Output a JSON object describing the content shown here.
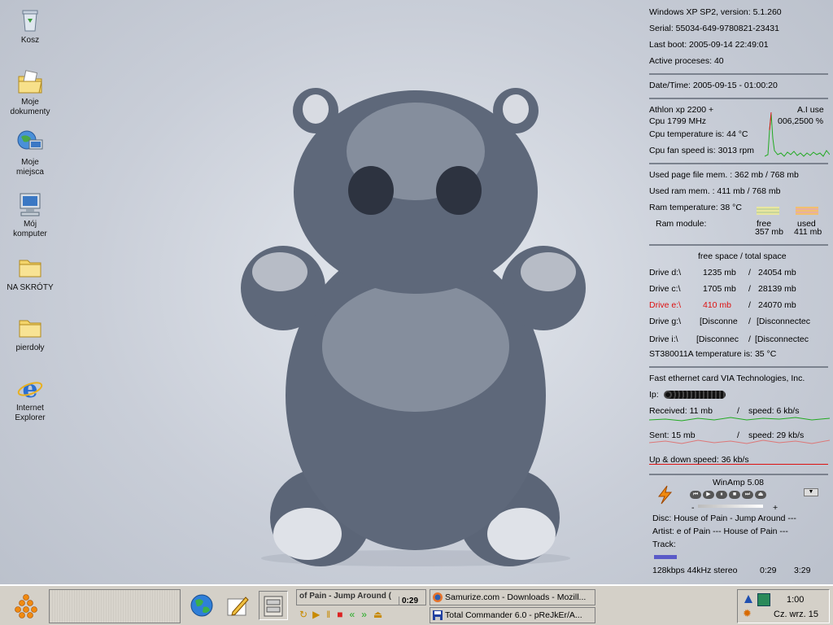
{
  "desktop_icons": [
    {
      "label": "Kosz",
      "icon": "recycle-bin-icon"
    },
    {
      "label": "Moje dokumenty",
      "icon": "my-documents-icon"
    },
    {
      "label": "Moje miejsca",
      "icon": "network-places-icon"
    },
    {
      "label": "Mój komputer",
      "icon": "my-computer-icon"
    },
    {
      "label": "NA SKRÓTY",
      "icon": "folder-icon"
    },
    {
      "label": "pierdoły",
      "icon": "folder-icon"
    },
    {
      "label": "Internet Explorer",
      "icon": "internet-explorer-icon"
    }
  ],
  "system": {
    "os": "Windows XP SP2, version:  5.1.260",
    "serial": "Serial:  55034-649-9780821-23431",
    "last_boot": "Last boot:  2005-09-14 22:49:01",
    "processes": "Active proceses: 40",
    "datetime": "Date/Time: 2005-09-15 - 01:00:20"
  },
  "cpu": {
    "model": "Athlon xp 2200 +",
    "ai_use": "A.I use",
    "freq": "Cpu     1799 MHz",
    "usage": "006,2500 %",
    "temp": "Cpu temperature is:   44 °C",
    "fan": "Cpu fan speed is:  3013 rpm"
  },
  "memory": {
    "page_file": "Used page file mem. :  362 mb   /   768 mb",
    "ram": "Used ram mem. :  411 mb    /    768 mb",
    "ram_temp": "Ram temperature:  38 °C",
    "module_label": "Ram module:",
    "free_label": "free",
    "free_val": "357 mb",
    "used_label": "used",
    "used_val": "411 mb"
  },
  "drives": {
    "header": "free space  /  total space",
    "rows": [
      {
        "name": "Drive  d:\\",
        "free": "1235 mb",
        "total": "24054 mb"
      },
      {
        "name": "Drive  c:\\",
        "free": "1705 mb",
        "total": "28139 mb"
      },
      {
        "name": "Drive  e:\\",
        "free": "410 mb",
        "total": "24070 mb"
      },
      {
        "name": "Drive  g:\\",
        "free": "[Disconne",
        "total": "[Disconnectec"
      },
      {
        "name": "Drive  i:\\",
        "free": "[Disconnec",
        "total": "[Disconnectec"
      }
    ],
    "hdd_temp": "ST380011A temperature is:  35 °C"
  },
  "network": {
    "card": "Fast ethernet card VIA Technologies, Inc.",
    "ip_label": "Ip:",
    "received": "Received: 11 mb",
    "received_speed": "speed: 6 kb/s",
    "sent": "Sent: 15 mb",
    "sent_speed": "speed: 29 kb/s",
    "updown": "Up & down speed: 36 kb/s"
  },
  "winamp": {
    "title": "WinAmp 5.08",
    "disc": "Disc:  House of Pain - Jump Around  ---",
    "artist": "Artist: e of Pain    ---    House of Pain   ---",
    "track": "Track:",
    "bitrate": "128kbps 44kHz stereo",
    "elapsed": "0:29",
    "total": "3:29",
    "vol_minus": "-",
    "vol_plus": "+"
  },
  "taskbar": {
    "winamp_title": "of Pain - Jump Around (",
    "winamp_time": "0:29",
    "window1": "Samurize.com - Downloads - Mozill...",
    "window2": "Total Commander 6.0 - pReJkEr/A...",
    "clock": "1:00",
    "date": "Cz. wrz. 15"
  },
  "colors": {
    "accent_red": "#dd1111",
    "graph_green": "#22aa22"
  }
}
